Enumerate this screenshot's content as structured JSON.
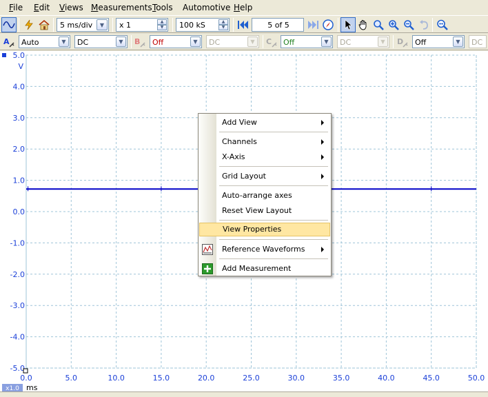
{
  "menubar": {
    "items": [
      {
        "label": "File",
        "mnemonic": "F",
        "rest": "ile"
      },
      {
        "label": "Edit",
        "mnemonic": "E",
        "rest": "dit"
      },
      {
        "label": "Views",
        "mnemonic": "V",
        "rest": "iews"
      },
      {
        "label": "Measurements",
        "mnemonic": "M",
        "rest": "easurements"
      },
      {
        "label": "Tools",
        "mnemonic": "T",
        "rest": "ools"
      },
      {
        "label": "Automotive",
        "mnemonic": "",
        "rest": "Automotive"
      },
      {
        "label": "Help",
        "mnemonic": "H",
        "rest": "elp"
      }
    ]
  },
  "toolbar": {
    "timebase": "5 ms/div",
    "zoom": "x 1",
    "samples": "100 kS",
    "buffer": "5 of 5"
  },
  "channels": {
    "a": {
      "label": "A",
      "range": "Auto",
      "coupling": "DC"
    },
    "b": {
      "label": "B",
      "range": "Off",
      "coupling": "DC"
    },
    "c": {
      "label": "C",
      "range": "Off",
      "coupling": "DC"
    },
    "d": {
      "label": "D",
      "range": "Off",
      "coupling": "DC"
    }
  },
  "plot": {
    "y_unit": "V",
    "x_unit": "ms",
    "x_zoom_badge": "x1.0",
    "y_ticks": [
      "5.0",
      "4.0",
      "3.0",
      "2.0",
      "1.0",
      "0.0",
      "-1.0",
      "-2.0",
      "-3.0",
      "-4.0",
      "-5.0"
    ],
    "x_ticks": [
      "0.0",
      "5.0",
      "10.0",
      "15.0",
      "20.0",
      "25.0",
      "30.0",
      "35.0",
      "40.0",
      "45.0",
      "50.0"
    ],
    "trace_color": "#0000c8",
    "axis_color": "#1a3fd8"
  },
  "chart_data": {
    "type": "line",
    "series": [
      {
        "name": "A",
        "x": [
          0,
          50
        ],
        "y": [
          0.72,
          0.72
        ]
      }
    ],
    "xlim": [
      0,
      50
    ],
    "ylim": [
      -5,
      5
    ],
    "xlabel": "ms",
    "ylabel": "V",
    "grid": true
  },
  "context_menu": {
    "items": [
      {
        "label": "Add View",
        "submenu": true
      },
      {
        "label": "Channels",
        "submenu": true
      },
      {
        "label": "X-Axis",
        "submenu": true
      },
      {
        "label": "Grid Layout",
        "submenu": true
      },
      {
        "label": "Auto-arrange axes",
        "submenu": false
      },
      {
        "label": "Reset View Layout",
        "submenu": false
      },
      {
        "label": "View Properties",
        "submenu": false,
        "highlighted": true
      },
      {
        "label": "Reference Waveforms",
        "submenu": true
      },
      {
        "label": "Add Measurement",
        "submenu": false
      }
    ]
  }
}
